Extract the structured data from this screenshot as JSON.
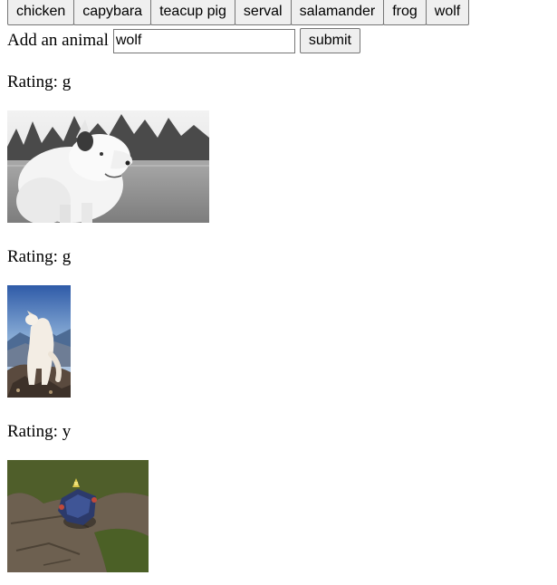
{
  "animal_buttons": [
    "chicken",
    "capybara",
    "teacup pig",
    "serval",
    "salamander",
    "frog",
    "wolf"
  ],
  "form": {
    "label": "Add an animal",
    "input_value": "wolf",
    "submit_label": "submit"
  },
  "results": [
    {
      "rating_label": "Rating: g",
      "image_subject": "white wolf in grassy field (grayscale)"
    },
    {
      "rating_label": "Rating: g",
      "image_subject": "white wolf on rocky cliff at dusk"
    },
    {
      "rating_label": "Rating: y",
      "image_subject": "video game character on stone terrain"
    }
  ]
}
